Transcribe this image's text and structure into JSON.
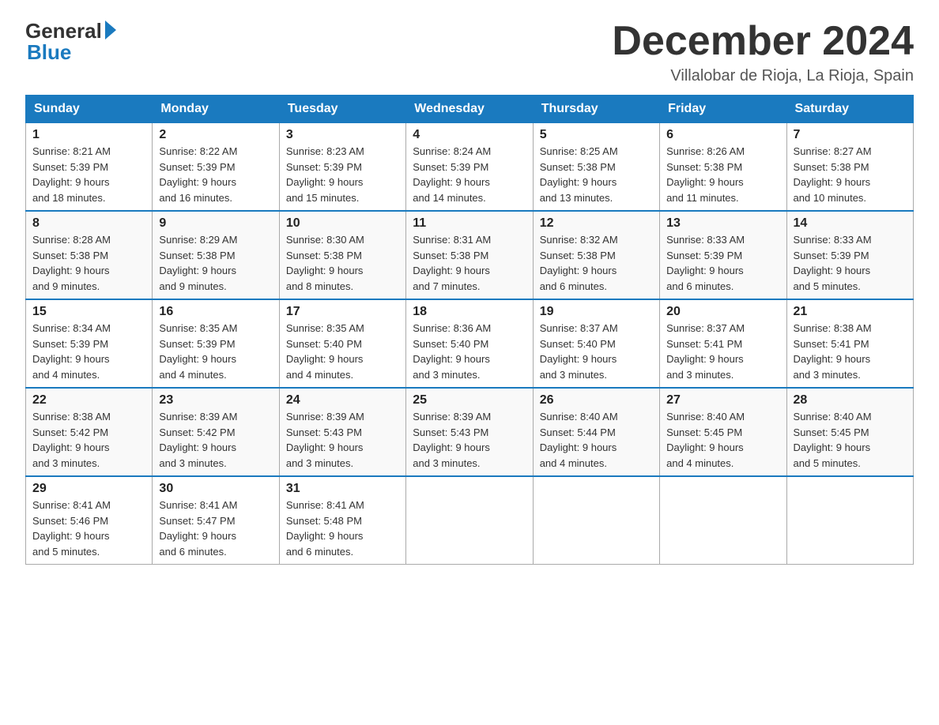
{
  "logo": {
    "general": "General",
    "blue": "Blue"
  },
  "title": "December 2024",
  "location": "Villalobar de Rioja, La Rioja, Spain",
  "days_of_week": [
    "Sunday",
    "Monday",
    "Tuesday",
    "Wednesday",
    "Thursday",
    "Friday",
    "Saturday"
  ],
  "weeks": [
    [
      {
        "day": "1",
        "sunrise": "8:21 AM",
        "sunset": "5:39 PM",
        "daylight": "9 hours and 18 minutes."
      },
      {
        "day": "2",
        "sunrise": "8:22 AM",
        "sunset": "5:39 PM",
        "daylight": "9 hours and 16 minutes."
      },
      {
        "day": "3",
        "sunrise": "8:23 AM",
        "sunset": "5:39 PM",
        "daylight": "9 hours and 15 minutes."
      },
      {
        "day": "4",
        "sunrise": "8:24 AM",
        "sunset": "5:39 PM",
        "daylight": "9 hours and 14 minutes."
      },
      {
        "day": "5",
        "sunrise": "8:25 AM",
        "sunset": "5:38 PM",
        "daylight": "9 hours and 13 minutes."
      },
      {
        "day": "6",
        "sunrise": "8:26 AM",
        "sunset": "5:38 PM",
        "daylight": "9 hours and 11 minutes."
      },
      {
        "day": "7",
        "sunrise": "8:27 AM",
        "sunset": "5:38 PM",
        "daylight": "9 hours and 10 minutes."
      }
    ],
    [
      {
        "day": "8",
        "sunrise": "8:28 AM",
        "sunset": "5:38 PM",
        "daylight": "9 hours and 9 minutes."
      },
      {
        "day": "9",
        "sunrise": "8:29 AM",
        "sunset": "5:38 PM",
        "daylight": "9 hours and 9 minutes."
      },
      {
        "day": "10",
        "sunrise": "8:30 AM",
        "sunset": "5:38 PM",
        "daylight": "9 hours and 8 minutes."
      },
      {
        "day": "11",
        "sunrise": "8:31 AM",
        "sunset": "5:38 PM",
        "daylight": "9 hours and 7 minutes."
      },
      {
        "day": "12",
        "sunrise": "8:32 AM",
        "sunset": "5:38 PM",
        "daylight": "9 hours and 6 minutes."
      },
      {
        "day": "13",
        "sunrise": "8:33 AM",
        "sunset": "5:39 PM",
        "daylight": "9 hours and 6 minutes."
      },
      {
        "day": "14",
        "sunrise": "8:33 AM",
        "sunset": "5:39 PM",
        "daylight": "9 hours and 5 minutes."
      }
    ],
    [
      {
        "day": "15",
        "sunrise": "8:34 AM",
        "sunset": "5:39 PM",
        "daylight": "9 hours and 4 minutes."
      },
      {
        "day": "16",
        "sunrise": "8:35 AM",
        "sunset": "5:39 PM",
        "daylight": "9 hours and 4 minutes."
      },
      {
        "day": "17",
        "sunrise": "8:35 AM",
        "sunset": "5:40 PM",
        "daylight": "9 hours and 4 minutes."
      },
      {
        "day": "18",
        "sunrise": "8:36 AM",
        "sunset": "5:40 PM",
        "daylight": "9 hours and 3 minutes."
      },
      {
        "day": "19",
        "sunrise": "8:37 AM",
        "sunset": "5:40 PM",
        "daylight": "9 hours and 3 minutes."
      },
      {
        "day": "20",
        "sunrise": "8:37 AM",
        "sunset": "5:41 PM",
        "daylight": "9 hours and 3 minutes."
      },
      {
        "day": "21",
        "sunrise": "8:38 AM",
        "sunset": "5:41 PM",
        "daylight": "9 hours and 3 minutes."
      }
    ],
    [
      {
        "day": "22",
        "sunrise": "8:38 AM",
        "sunset": "5:42 PM",
        "daylight": "9 hours and 3 minutes."
      },
      {
        "day": "23",
        "sunrise": "8:39 AM",
        "sunset": "5:42 PM",
        "daylight": "9 hours and 3 minutes."
      },
      {
        "day": "24",
        "sunrise": "8:39 AM",
        "sunset": "5:43 PM",
        "daylight": "9 hours and 3 minutes."
      },
      {
        "day": "25",
        "sunrise": "8:39 AM",
        "sunset": "5:43 PM",
        "daylight": "9 hours and 3 minutes."
      },
      {
        "day": "26",
        "sunrise": "8:40 AM",
        "sunset": "5:44 PM",
        "daylight": "9 hours and 4 minutes."
      },
      {
        "day": "27",
        "sunrise": "8:40 AM",
        "sunset": "5:45 PM",
        "daylight": "9 hours and 4 minutes."
      },
      {
        "day": "28",
        "sunrise": "8:40 AM",
        "sunset": "5:45 PM",
        "daylight": "9 hours and 5 minutes."
      }
    ],
    [
      {
        "day": "29",
        "sunrise": "8:41 AM",
        "sunset": "5:46 PM",
        "daylight": "9 hours and 5 minutes."
      },
      {
        "day": "30",
        "sunrise": "8:41 AM",
        "sunset": "5:47 PM",
        "daylight": "9 hours and 6 minutes."
      },
      {
        "day": "31",
        "sunrise": "8:41 AM",
        "sunset": "5:48 PM",
        "daylight": "9 hours and 6 minutes."
      },
      null,
      null,
      null,
      null
    ]
  ],
  "labels": {
    "sunrise": "Sunrise:",
    "sunset": "Sunset:",
    "daylight": "Daylight:"
  }
}
